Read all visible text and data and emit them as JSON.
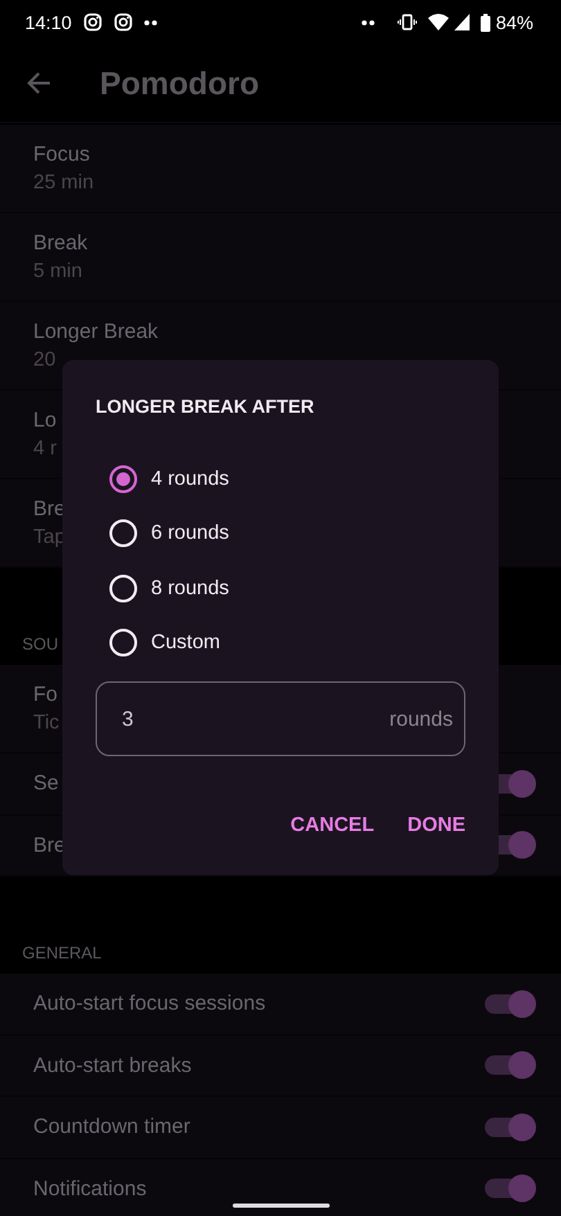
{
  "status_bar": {
    "time": "14:10",
    "battery": "84%"
  },
  "app_bar": {
    "title": "Pomodoro"
  },
  "sections": [
    {
      "items": [
        {
          "kind": "value",
          "title": "Focus",
          "value": "25 min"
        },
        {
          "kind": "value",
          "title": "Break",
          "value": "5 min"
        },
        {
          "kind": "value",
          "title": "Longer Break",
          "value": "20"
        },
        {
          "kind": "value",
          "title": "Lo",
          "value": "4 r"
        },
        {
          "kind": "value",
          "title": "Bre",
          "value": "Tap"
        }
      ]
    },
    {
      "header": "SOU",
      "items": [
        {
          "kind": "value",
          "title": "Fo",
          "value": "Tic"
        },
        {
          "kind": "toggle",
          "title": "Se",
          "on": true
        },
        {
          "kind": "toggle",
          "title": "Bre",
          "on": true
        }
      ]
    },
    {
      "header": "GENERAL",
      "items": [
        {
          "kind": "toggle",
          "title": "Auto-start focus sessions",
          "on": true
        },
        {
          "kind": "toggle",
          "title": "Auto-start breaks",
          "on": true
        },
        {
          "kind": "toggle",
          "title": "Countdown timer",
          "on": true
        },
        {
          "kind": "toggle",
          "title": "Notifications",
          "on": true
        }
      ]
    }
  ],
  "dialog": {
    "title": "LONGER BREAK AFTER",
    "options": [
      {
        "label": "4 rounds",
        "selected": true
      },
      {
        "label": "6 rounds",
        "selected": false
      },
      {
        "label": "8 rounds",
        "selected": false
      },
      {
        "label": "Custom",
        "selected": false
      }
    ],
    "field": {
      "value": "3",
      "suffix": "rounds"
    },
    "buttons": [
      "CANCEL",
      "DONE"
    ]
  }
}
